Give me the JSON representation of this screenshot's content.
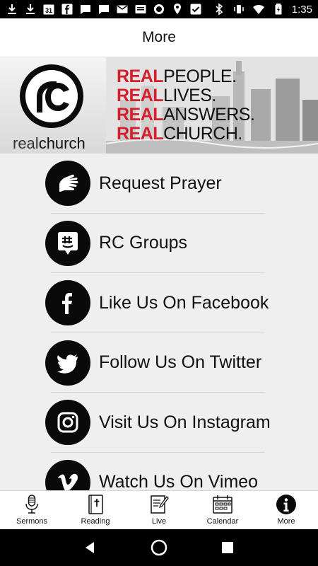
{
  "status_bar": {
    "time": "1:35",
    "calendar_day": "31"
  },
  "app_bar": {
    "title": "More"
  },
  "banner": {
    "logo_text_light": "real",
    "logo_text_bold": "church",
    "lines": [
      {
        "red": "REAL",
        "black": "PEOPLE."
      },
      {
        "red": "REAL",
        "black": "LIVES."
      },
      {
        "red": "REAL",
        "black": "ANSWERS."
      },
      {
        "red": "REAL",
        "black": "CHURCH."
      }
    ]
  },
  "menu": {
    "items": [
      {
        "label": "Request Prayer",
        "icon": "praying-hands-icon"
      },
      {
        "label": "RC Groups",
        "icon": "groupme-icon"
      },
      {
        "label": "Like Us On Facebook",
        "icon": "facebook-icon"
      },
      {
        "label": "Follow Us On Twitter",
        "icon": "twitter-icon"
      },
      {
        "label": "Visit Us On Instagram",
        "icon": "instagram-icon"
      },
      {
        "label": "Watch Us On Vimeo",
        "icon": "vimeo-icon"
      }
    ]
  },
  "tabs": [
    {
      "label": "Sermons",
      "icon": "microphone-icon"
    },
    {
      "label": "Reading",
      "icon": "bible-icon"
    },
    {
      "label": "Live",
      "icon": "notepad-icon"
    },
    {
      "label": "Calendar",
      "icon": "calendar-icon"
    },
    {
      "label": "More",
      "icon": "info-icon",
      "active": true
    }
  ],
  "colors": {
    "accent_red": "#d4202c",
    "icon_black": "#0a0a0a",
    "list_background": "#efefef"
  }
}
